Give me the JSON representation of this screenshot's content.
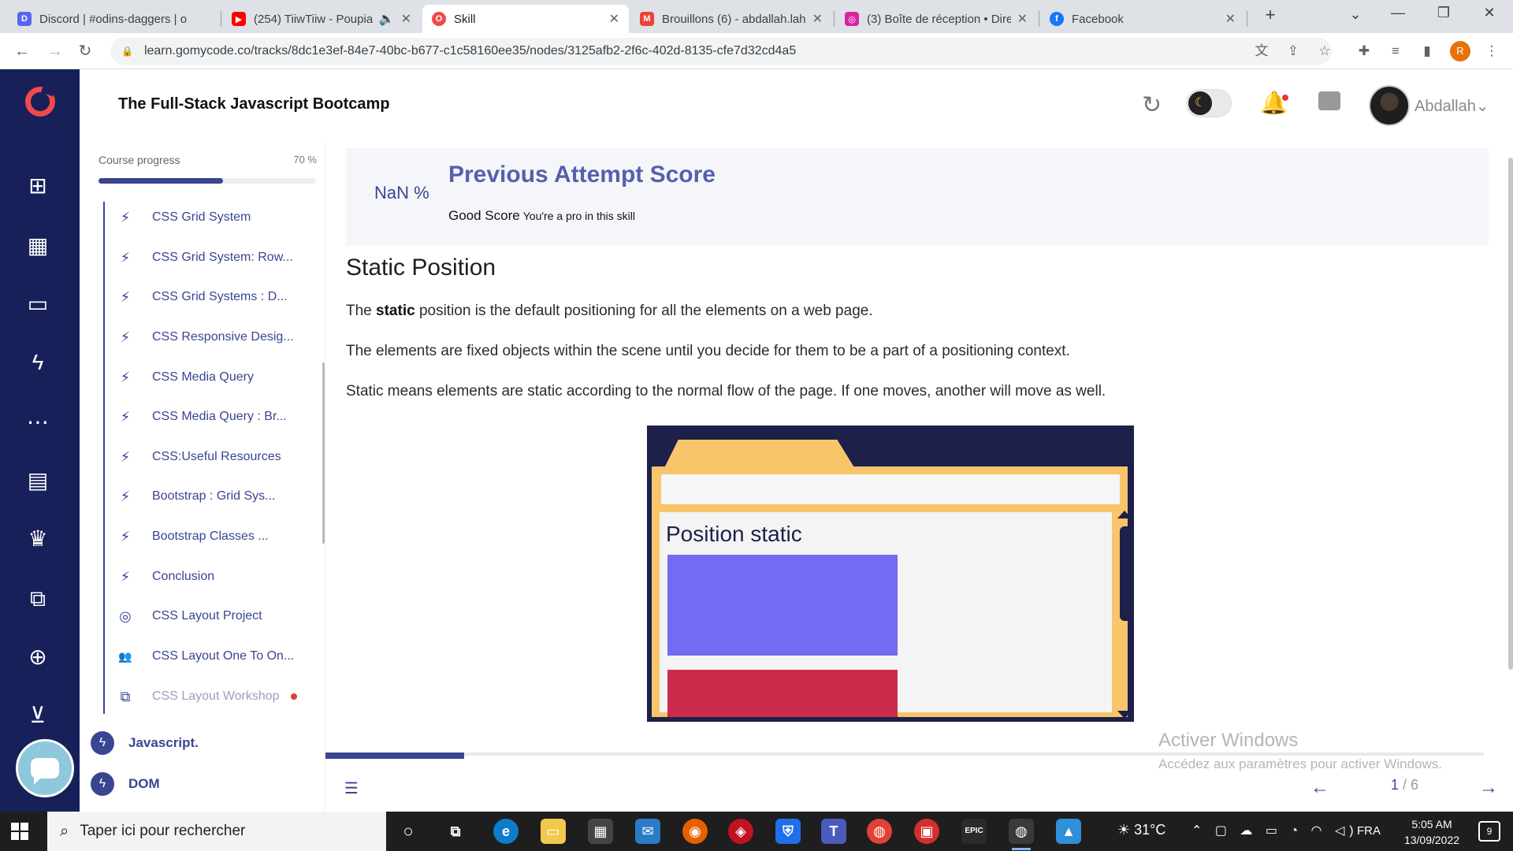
{
  "browser": {
    "tabs": [
      {
        "title": "Discord | #odins-daggers | o",
        "favicon": "discord-icon",
        "color": "#5865f2",
        "letter": "D"
      },
      {
        "title": "(254) TiiwTiiw - Poupia",
        "favicon": "youtube-icon",
        "color": "#ff0000",
        "letter": "▶"
      },
      {
        "title": "Skill",
        "favicon": "gomycode-icon",
        "color": "#f04a4a",
        "letter": "O"
      },
      {
        "title": "Brouillons (6) - abdallah.lah",
        "favicon": "gmail-icon",
        "color": "#ea4335",
        "letter": "M"
      },
      {
        "title": "(3) Boîte de réception • Dire",
        "favicon": "instagram-icon",
        "color": "#d6249f",
        "letter": "◎"
      },
      {
        "title": "Facebook",
        "favicon": "facebook-icon",
        "color": "#1877f2",
        "letter": "f"
      }
    ],
    "new_tab": "+",
    "url": "learn.gomycode.co/tracks/8dc1e3ef-84e7-40bc-b677-c1c58160ee35/nodes/3125afb2-2f6c-402d-8135-cfe7d32cd4a5",
    "profile_letter": "R"
  },
  "app": {
    "title": "The Full-Stack Javascript Bootcamp",
    "username": "Abdallah",
    "progress_label": "Course progress",
    "progress_pct": "70 %",
    "progress_value": 0.7
  },
  "lessons": [
    {
      "label": "CSS Grid System",
      "icon": "bolt-icon",
      "glyph": "⚡"
    },
    {
      "label": "CSS Grid System: Row...",
      "icon": "bolt-icon",
      "glyph": "⚡"
    },
    {
      "label": "CSS Grid Systems : D...",
      "icon": "bolt-icon",
      "glyph": "⚡"
    },
    {
      "label": "CSS Responsive Desig...",
      "icon": "bolt-icon",
      "glyph": "⚡"
    },
    {
      "label": "CSS Media Query",
      "icon": "bolt-icon",
      "glyph": "⚡"
    },
    {
      "label": "CSS Media Query : Br...",
      "icon": "bolt-icon",
      "glyph": "⚡"
    },
    {
      "label": "CSS:Useful Resources",
      "icon": "bolt-icon",
      "glyph": "⚡"
    },
    {
      "label": "Bootstrap : Grid Sys...",
      "icon": "bolt-icon",
      "glyph": "⚡"
    },
    {
      "label": "Bootstrap Classes ...",
      "icon": "bolt-icon",
      "glyph": "⚡"
    },
    {
      "label": "Conclusion",
      "icon": "bolt-icon",
      "glyph": "⚡"
    },
    {
      "label": "CSS Layout Project",
      "icon": "target-icon",
      "glyph": "◎"
    },
    {
      "label": "CSS Layout One To On...",
      "icon": "people-icon",
      "glyph": "👥"
    },
    {
      "label": "CSS Layout Workshop",
      "icon": "workshop-icon",
      "glyph": "⧉",
      "dim": true,
      "dot": true
    }
  ],
  "modules": [
    {
      "label": "Javascript."
    },
    {
      "label": "DOM"
    }
  ],
  "score": {
    "pct": "NaN %",
    "title": "Previous Attempt Score",
    "good": "Good Score",
    "sub": "You're a pro in this skill"
  },
  "content": {
    "heading": "Static Position",
    "p1_pre": "The ",
    "p1_bold": "static",
    "p1_post": " position is the default positioning for all the elements on a web page.",
    "p2": "The elements are fixed objects within the scene until you decide for them to be a part of a positioning context.",
    "p3": "Static means elements are static according to the normal flow of the page. If one moves, another will move as well.",
    "illustration_label": "Position static"
  },
  "pager": {
    "current": "1",
    "total": "/ 6",
    "progress_value": 0.12
  },
  "watermark": {
    "line1": "Activer Windows",
    "line2": "Accédez aux paramètres pour activer Windows."
  },
  "taskbar": {
    "search_placeholder": "Taper ici pour rechercher",
    "temperature": "31°C",
    "language": "FRA",
    "time": "5:05 AM",
    "date": "13/09/2022",
    "notification_count": "9"
  },
  "colors": {
    "brand_navy": "#172058",
    "accent": "#3a4591",
    "brand_red": "#f04a4a"
  }
}
